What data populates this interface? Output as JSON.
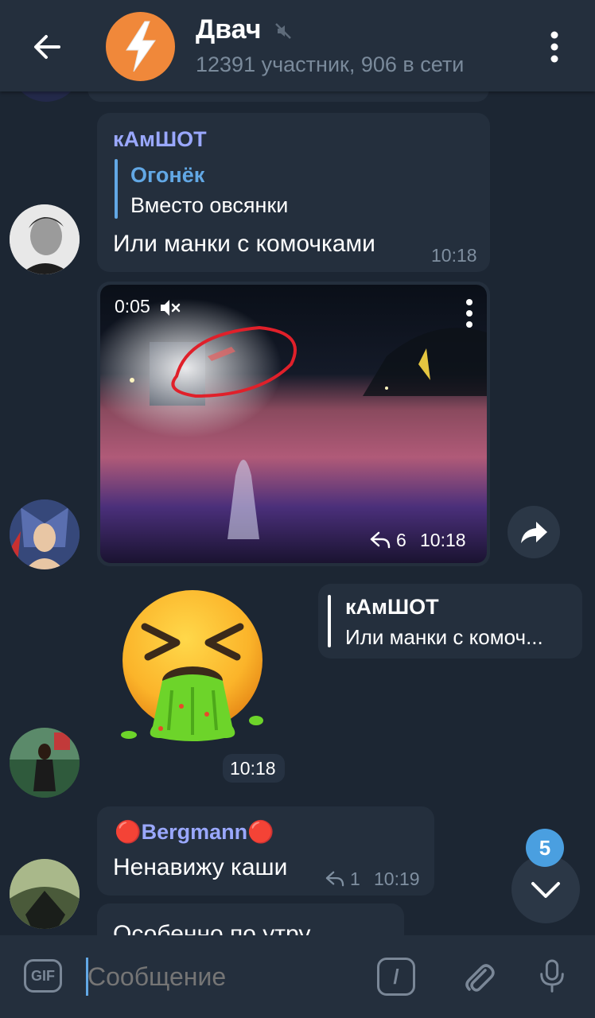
{
  "header": {
    "title": "Двач",
    "subtitle": "12391 участник, 906 в сети"
  },
  "messages": [
    {
      "sender": "кАмШОТ",
      "reply_name": "Огонёк",
      "reply_text": "Вместо овсянки",
      "text": "Или манки с комочками",
      "time": "10:18"
    },
    {
      "video_duration": "0:05",
      "replies": "6",
      "time": "10:18"
    },
    {
      "reply_name": "кАмШОТ",
      "reply_text": "Или манки с комоч...",
      "time": "10:18"
    },
    {
      "sender": "🔴Bergmann🔴",
      "text": "Ненавижу каши",
      "replies": "1",
      "time": "10:19"
    },
    {
      "text": "Особенно по утру"
    }
  ],
  "unread_count": "5",
  "input": {
    "placeholder": "Сообщение",
    "gif_label": "GIF",
    "command_label": "/"
  },
  "colors": {
    "background": "#1c2633",
    "bubble": "#242f3d",
    "accent": "#62a8e5",
    "sender_name": "#9aa8ff"
  },
  "icons": [
    "back-arrow-icon",
    "bolt-icon",
    "mute-icon",
    "more-vert-icon",
    "sound-off-icon",
    "reply-icon",
    "share-icon",
    "chevron-down-icon",
    "attach-icon",
    "mic-icon",
    "vomit-emoji-icon"
  ]
}
